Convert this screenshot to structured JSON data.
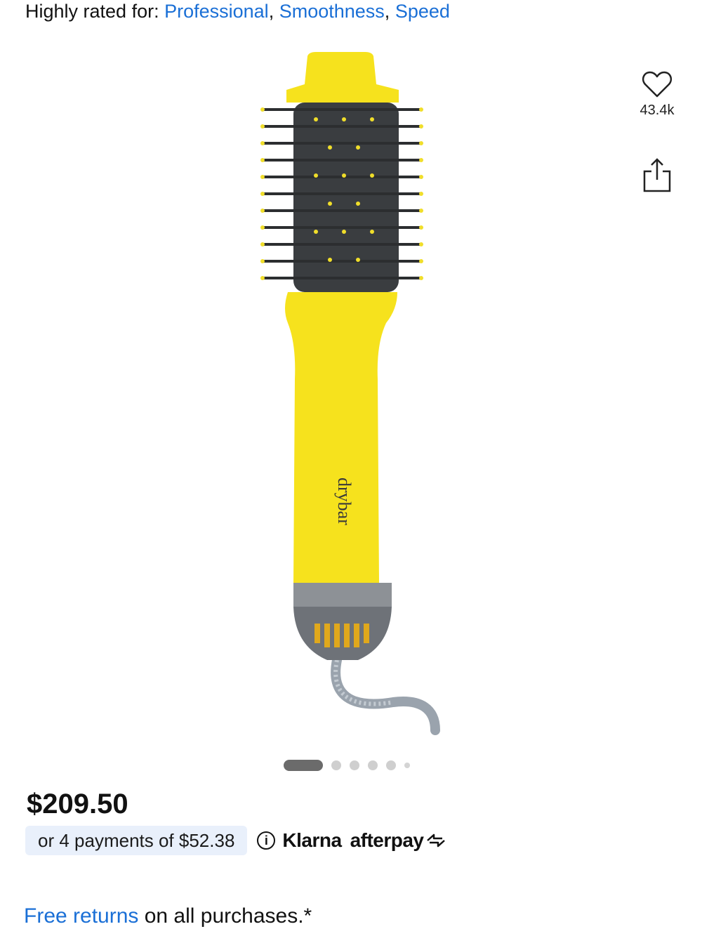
{
  "rated": {
    "prefix": "Highly rated for: ",
    "tags": [
      "Professional",
      "Smoothness",
      "Speed"
    ],
    "separator": ", "
  },
  "product": {
    "brand_mark": "drybar",
    "image_icon": "hair-dryer-brush-image",
    "colors": {
      "body": "#f6e21d",
      "barrel": "#3a3d40",
      "base": "#8d9196",
      "accent": "#1a6fd6"
    }
  },
  "actions": {
    "favorite_icon": "heart-outline-icon",
    "favorite_count": "43.4k",
    "share_icon": "share-icon"
  },
  "carousel": {
    "total": 6,
    "active_index": 0
  },
  "pricing": {
    "price": "$209.50",
    "installment": "or 4 payments of $52.38",
    "info_icon": "info-circle-icon",
    "providers": [
      "Klarna",
      "afterpay"
    ]
  },
  "returns": {
    "link_text": "Free returns",
    "rest_text": " on all purchases.*"
  }
}
